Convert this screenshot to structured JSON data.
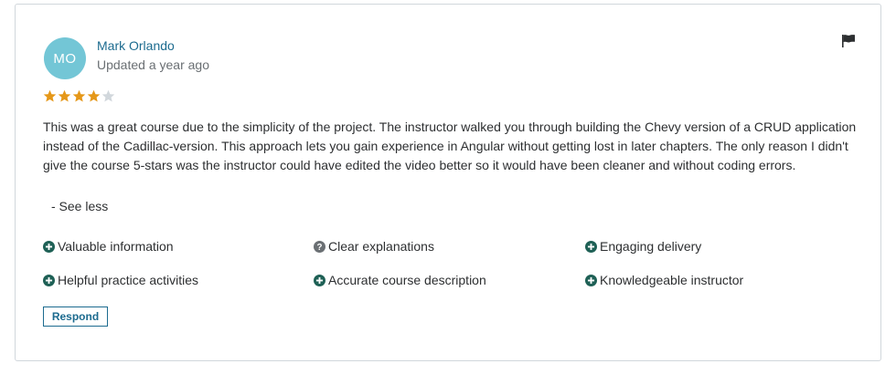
{
  "review": {
    "avatar_initials": "MO",
    "author": "Mark Orlando",
    "updated": "Updated a year ago",
    "rating": 4,
    "rating_max": 5,
    "text": "This was a great course due to the simplicity of the project. The instructor walked you through building the Chevy version of a CRUD application instead of the Cadillac-version. This approach lets you gain experience in Angular without getting lost in later chapters. The only reason I didn't give the course 5-stars was the instructor could have edited the video better so it would have been cleaner and without coding errors.",
    "see_less": "- See less",
    "respond_label": "Respond"
  },
  "tags": [
    {
      "label": "Valuable information",
      "icon": "plus-circle-icon"
    },
    {
      "label": "Clear explanations",
      "icon": "question-circle-icon"
    },
    {
      "label": "Engaging delivery",
      "icon": "plus-circle-icon"
    },
    {
      "label": "Helpful practice activities",
      "icon": "plus-circle-icon"
    },
    {
      "label": "Accurate course description",
      "icon": "plus-circle-icon"
    },
    {
      "label": "Knowledgeable instructor",
      "icon": "plus-circle-icon"
    }
  ],
  "colors": {
    "avatar_bg": "#73c6d6",
    "star_filled": "#e59819",
    "star_empty": "#d1d7dc",
    "positive_icon": "#1e6055",
    "neutral_icon": "#6a6f73",
    "link": "#1c6b8f"
  }
}
